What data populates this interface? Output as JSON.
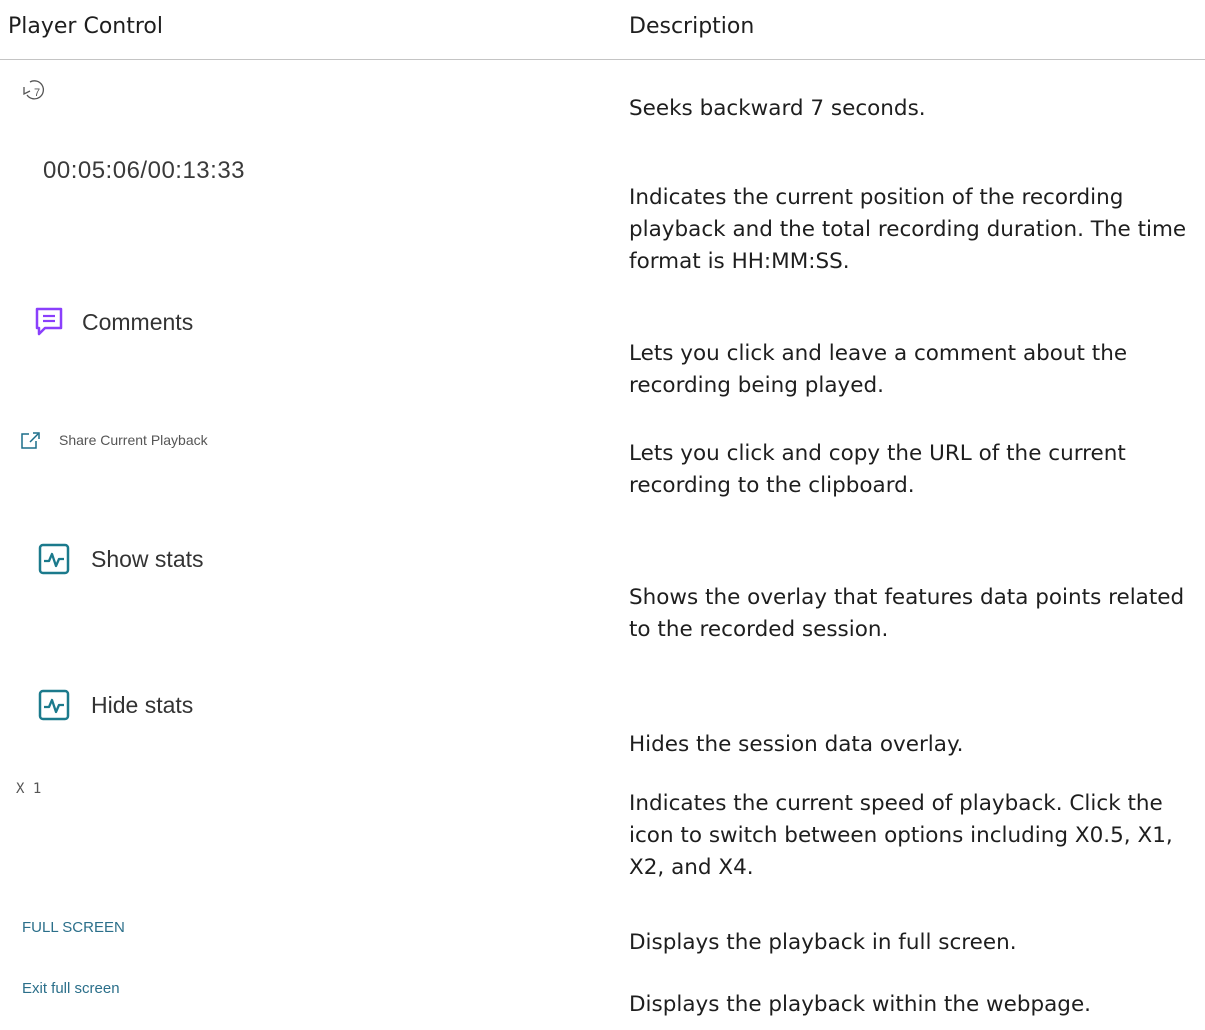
{
  "table": {
    "col_control": "Player Control",
    "col_description": "Description"
  },
  "rows": [
    {
      "icon": "rewind-7-icon",
      "control": "",
      "description": "Seeks backward 7 seconds."
    },
    {
      "control": "00:05:06/00:13:33",
      "description": "Indicates the current position of the recording playback and the total recording duration. The time format is HH:MM:SS."
    },
    {
      "icon": "comment-icon",
      "control": "Comments",
      "description": "Lets you click and leave a comment about the recording being played."
    },
    {
      "icon": "share-icon",
      "control": "Share Current Playback",
      "description": "Lets you click and copy the URL of the current recording to the clipboard."
    },
    {
      "icon": "stats-icon",
      "control": "Show stats",
      "description": "Shows the overlay that features data points related to the recorded session."
    },
    {
      "icon": "stats-icon",
      "control": "Hide stats",
      "description": "Hides the session data overlay."
    },
    {
      "control": "X 1",
      "description": "Indicates the current speed of playback. Click the icon to switch between options including X0.5, X1, X2, and X4."
    },
    {
      "control": "FULL SCREEN",
      "description": "Displays the playback in full screen."
    },
    {
      "control": "Exit full screen",
      "description": "Displays the playback within the webpage."
    }
  ],
  "icon_glyphs": {
    "rewind_number": "7"
  },
  "colors": {
    "comment_icon": "#8a3ffc",
    "stats_icon": "#1b7a8c",
    "fullscreen_text": "#2b6f8a",
    "rule": "#c4c4c4"
  }
}
